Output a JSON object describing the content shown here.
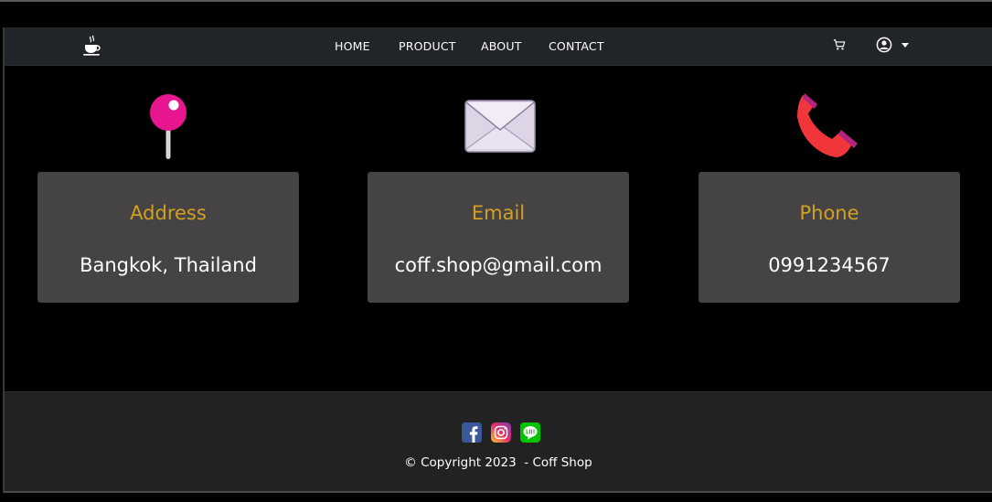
{
  "navbar": {
    "logo_icon": "coffee-cup-icon",
    "links": [
      {
        "label": "HOME"
      },
      {
        "label": "PRODUCT"
      },
      {
        "label": "ABOUT"
      },
      {
        "label": "CONTACT"
      }
    ],
    "cart_icon": "cart-icon",
    "user_icon": "user-circle-icon",
    "caret_icon": "caret-down-icon"
  },
  "contact": {
    "cards": [
      {
        "icon": "map-pin-icon",
        "title": "Address",
        "value": "Bangkok, Thailand"
      },
      {
        "icon": "envelope-icon",
        "title": "Email",
        "value": "coff.shop@gmail.com"
      },
      {
        "icon": "phone-icon",
        "title": "Phone",
        "value": "0991234567"
      }
    ]
  },
  "footer": {
    "social": [
      {
        "name": "facebook-icon",
        "color": "#3b5998"
      },
      {
        "name": "instagram-icon",
        "color": "#e1306c"
      },
      {
        "name": "line-icon",
        "color": "#00c300"
      }
    ],
    "copyright": "© Copyright 2023  - Coff Shop"
  },
  "colors": {
    "navbar_bg": "#212529",
    "card_bg": "#454344",
    "card_title": "#d4a021",
    "footer_bg": "#222222"
  }
}
